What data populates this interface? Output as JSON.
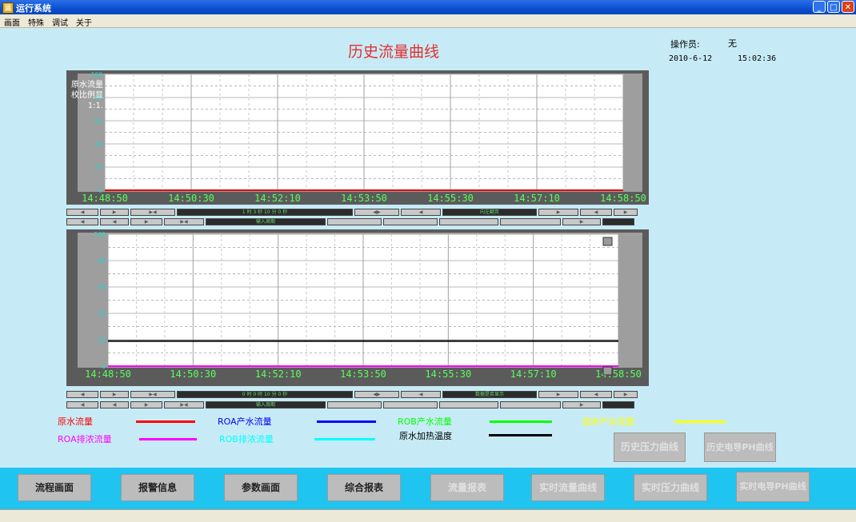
{
  "window": {
    "title": "运行系统",
    "icon_glyph": "运",
    "min_glyph": "_",
    "max_glyph": "□",
    "close_glyph": "✕"
  },
  "menu": [
    "画面",
    "特殊",
    "调试",
    "关于"
  ],
  "page_title": "历史流量曲线",
  "operator": {
    "label": "操作员:",
    "value": "无",
    "date": "2010-6-12",
    "time": "15:02:36"
  },
  "chart1": {
    "time_labels": [
      "14:48:50",
      "14:50:30",
      "14:52:10",
      "14:53:50",
      "14:55:30",
      "14:57:10",
      "14:58:50"
    ],
    "y_ticks": [
      "100",
      "80",
      "60",
      "40",
      "20",
      "0"
    ],
    "side_labels": [
      "原水流量",
      "校比例显",
      "1:1."
    ],
    "series": [
      {
        "name": "原水流量",
        "color": "#e00000",
        "values": [
          0,
          0
        ]
      }
    ]
  },
  "chart2": {
    "time_labels": [
      "14:48:50",
      "14:50:30",
      "14:52:10",
      "14:53:50",
      "14:55:30",
      "14:57:10",
      "14:58:50"
    ],
    "y_ticks": [
      "100",
      "80",
      "60",
      "40",
      "20",
      "0"
    ],
    "series": [
      {
        "name": "原水加热温度",
        "color": "#000000",
        "values": [
          19,
          19
        ]
      },
      {
        "name": "ROA排浓流量",
        "color": "#ff00ff",
        "values": [
          0,
          0
        ]
      }
    ]
  },
  "controls1": {
    "display": "1 时 3 秒 10 分 0 秒",
    "label": "向左翻页",
    "mode": "输入周期"
  },
  "controls2": {
    "display": "0 时 0 时 10 分 0 秒",
    "label": "数据是否显示",
    "mode": "输入周期"
  },
  "legend": [
    {
      "label": "原水流量",
      "color": "#ff0000",
      "text_color": "#ff0000"
    },
    {
      "label": "ROA产水流量",
      "color": "#0000ff",
      "text_color": "#0000ff"
    },
    {
      "label": "ROB产水流量",
      "color": "#00ff00",
      "text_color": "#00ff00"
    },
    {
      "label": "混床产水流量",
      "color": "#ffff00",
      "text_color": "#ffff00"
    },
    {
      "label": "ROA排浓流量",
      "color": "#ff00ff",
      "text_color": "#ff00ff"
    },
    {
      "label": "ROB排浓流量",
      "color": "#00ffff",
      "text_color": "#00ffff"
    },
    {
      "label": "原水加热温度",
      "color": "#000000",
      "text_color": "#000000"
    }
  ],
  "side_buttons": [
    "历史压力曲线",
    "历史电导PH曲线"
  ],
  "nav_buttons": [
    {
      "label": "流程画面",
      "enabled": true
    },
    {
      "label": "报警信息",
      "enabled": true
    },
    {
      "label": "参数画面",
      "enabled": true
    },
    {
      "label": "综合报表",
      "enabled": true
    },
    {
      "label": "流量报表",
      "enabled": false
    },
    {
      "label": "实时流量曲线",
      "enabled": false
    },
    {
      "label": "实时压力曲线",
      "enabled": false
    },
    {
      "label": "实时电导PH曲线",
      "enabled": false
    }
  ]
}
